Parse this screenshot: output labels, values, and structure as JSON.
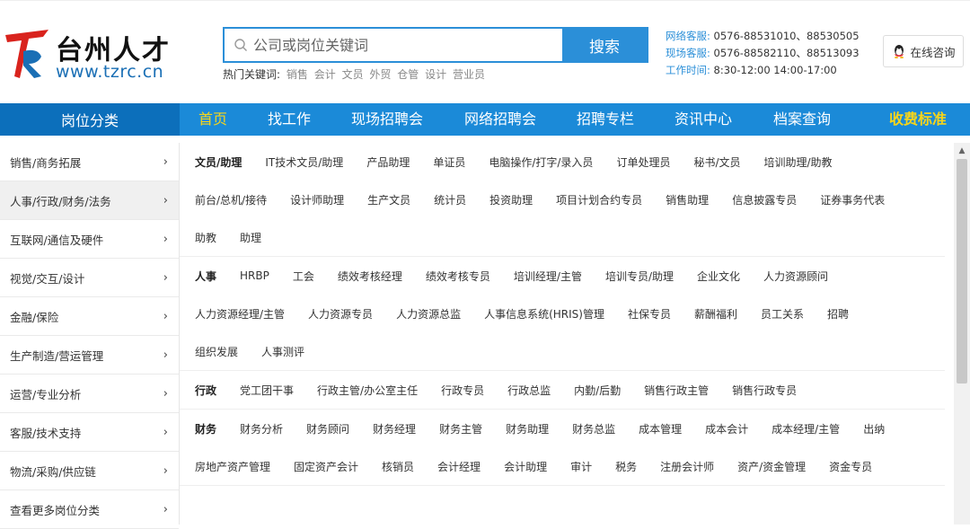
{
  "header": {
    "logo_text": "台州人才",
    "logo_url": "www.tzrc.cn",
    "search": {
      "placeholder": "公司或岗位关键词",
      "button_label": "搜索"
    },
    "hot_keywords": {
      "label": "热门关键词:",
      "items": [
        "销售",
        "会计",
        "文员",
        "外贸",
        "仓管",
        "设计",
        "营业员"
      ]
    },
    "contact": [
      {
        "label": "网络客服:",
        "value": "0576-88531010、88530505"
      },
      {
        "label": "现场客服:",
        "value": "0576-88582110、88513093"
      },
      {
        "label": "工作时间:",
        "value": "8:30-12:00 14:00-17:00"
      }
    ],
    "online_consult": "在线咨询"
  },
  "nav": {
    "category_label": "岗位分类",
    "items": [
      "首页",
      "找工作",
      "现场招聘会",
      "网络招聘会",
      "招聘专栏",
      "资讯中心",
      "档案查询",
      "收费标准"
    ]
  },
  "sidebar": {
    "items": [
      "销售/商务拓展",
      "人事/行政/财务/法务",
      "互联网/通信及硬件",
      "视觉/交互/设计",
      "金融/保险",
      "生产制造/营运管理",
      "运营/专业分析",
      "客服/技术支持",
      "物流/采购/供应链",
      "查看更多岗位分类"
    ],
    "chevron": "›"
  },
  "panel": {
    "groups": [
      {
        "title": "文员/助理",
        "rows": [
          [
            "IT技术文员/助理",
            "产品助理",
            "单证员",
            "电脑操作/打字/录入员",
            "订单处理员",
            "秘书/文员",
            "培训助理/助教"
          ],
          [
            "前台/总机/接待",
            "设计师助理",
            "生产文员",
            "统计员",
            "投资助理",
            "项目计划合约专员",
            "销售助理",
            "信息披露专员",
            "证券事务代表"
          ],
          [
            "助教",
            "助理"
          ]
        ]
      },
      {
        "title": "人事",
        "rows": [
          [
            "HRBP",
            "工会",
            "绩效考核经理",
            "绩效考核专员",
            "培训经理/主管",
            "培训专员/助理",
            "企业文化",
            "人力资源顾问"
          ],
          [
            "人力资源经理/主管",
            "人力资源专员",
            "人力资源总监",
            "人事信息系统(HRIS)管理",
            "社保专员",
            "薪酬福利",
            "员工关系",
            "招聘"
          ],
          [
            "组织发展",
            "人事测评"
          ]
        ]
      },
      {
        "title": "行政",
        "rows": [
          [
            "党工团干事",
            "行政主管/办公室主任",
            "行政专员",
            "行政总监",
            "内勤/后勤",
            "销售行政主管",
            "销售行政专员"
          ]
        ]
      },
      {
        "title": "财务",
        "rows": [
          [
            "财务分析",
            "财务顾问",
            "财务经理",
            "财务主管",
            "财务助理",
            "财务总监",
            "成本管理",
            "成本会计",
            "成本经理/主管",
            "出纳"
          ],
          [
            "房地产资产管理",
            "固定资产会计",
            "核销员",
            "会计经理",
            "会计助理",
            "审计",
            "税务",
            "注册会计师",
            "资产/资金管理",
            "资金专员"
          ]
        ]
      }
    ]
  },
  "colors": {
    "brand_blue": "#1b8ad8",
    "nav_dark": "#0c6fbb",
    "highlight_yellow": "#f7d51a",
    "logo_red": "#d9231d"
  }
}
